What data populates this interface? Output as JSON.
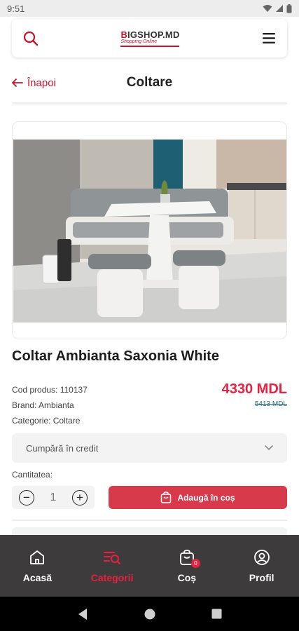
{
  "status_bar": {
    "time": "9:51"
  },
  "header": {
    "logo_prefix": "B",
    "logo_main": "IGSHOP.MD",
    "logo_sub": "Shopping Online"
  },
  "page": {
    "back_label": "Înapoi",
    "title": "Coltare"
  },
  "product": {
    "title": "Coltar Ambianta Saxonia White",
    "code": "Cod produs: 110137",
    "brand": "Brand: Ambianta",
    "category": "Categorie: Coltare",
    "price": "4330 MDL",
    "old_price": "5413 MDL",
    "credit_label": "Cumpără în credit",
    "quantity_label": "Cantitatea:",
    "quantity_value": "1",
    "add_to_cart_label": "Adaugă în coș"
  },
  "bottom_nav": {
    "items": [
      {
        "label": "Acasă",
        "icon": "home-icon"
      },
      {
        "label": "Categorii",
        "icon": "categories-search-icon",
        "active": true
      },
      {
        "label": "Coș",
        "icon": "cart-icon",
        "badge": "0"
      },
      {
        "label": "Profil",
        "icon": "profile-icon"
      }
    ]
  },
  "colors": {
    "brand_red": "#d1112a",
    "price_red": "#e8213f",
    "nav_bg": "#3d3b3b",
    "button_red": "#d63a4b"
  }
}
